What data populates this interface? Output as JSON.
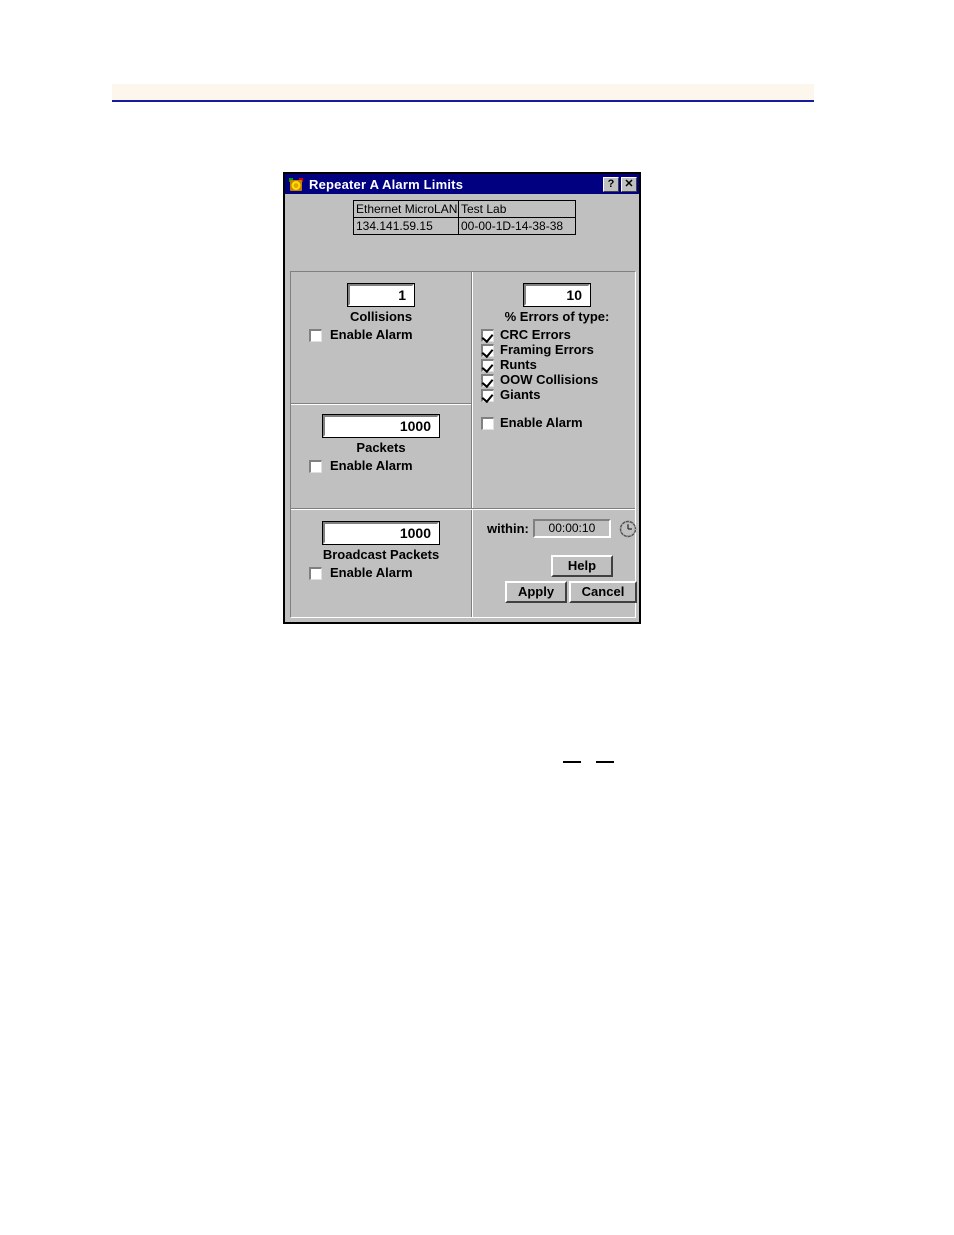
{
  "window": {
    "title": "Repeater A Alarm Limits",
    "icon": "alarm-clock-icon",
    "help_button": "?",
    "close_button": "✕",
    "titlebar_color": "#000080"
  },
  "info_table": {
    "rows": [
      [
        "Ethernet MicroLAN",
        "Test Lab"
      ],
      [
        "134.141.59.15",
        "00-00-1D-14-38-38"
      ]
    ]
  },
  "groups": {
    "collisions": {
      "value": "1",
      "label": "Collisions",
      "enable_alarm_label": "Enable Alarm",
      "enable_alarm_checked": false
    },
    "packets": {
      "value": "1000",
      "label": "Packets",
      "enable_alarm_label": "Enable Alarm",
      "enable_alarm_checked": false
    },
    "broadcast_packets": {
      "value": "1000",
      "label": "Broadcast Packets",
      "enable_alarm_label": "Enable Alarm",
      "enable_alarm_checked": false
    },
    "errors": {
      "value": "10",
      "label": "% Errors of type:",
      "types": [
        {
          "label": "CRC Errors",
          "checked": true
        },
        {
          "label": "Framing Errors",
          "checked": true
        },
        {
          "label": "Runts",
          "checked": true
        },
        {
          "label": "OOW Collisions",
          "checked": true
        },
        {
          "label": "Giants",
          "checked": true
        }
      ],
      "enable_alarm_label": "Enable Alarm",
      "enable_alarm_checked": false
    }
  },
  "within": {
    "label": "within:",
    "value": "00:00:10",
    "icon": "clock-icon"
  },
  "buttons": {
    "help": "Help",
    "apply": "Apply",
    "cancel": "Cancel"
  },
  "theme": {
    "face": "#c0c0c0",
    "shadow": "#808080",
    "highlight": "#ffffff",
    "text": "#000000",
    "rule": "#1a1a9c"
  }
}
